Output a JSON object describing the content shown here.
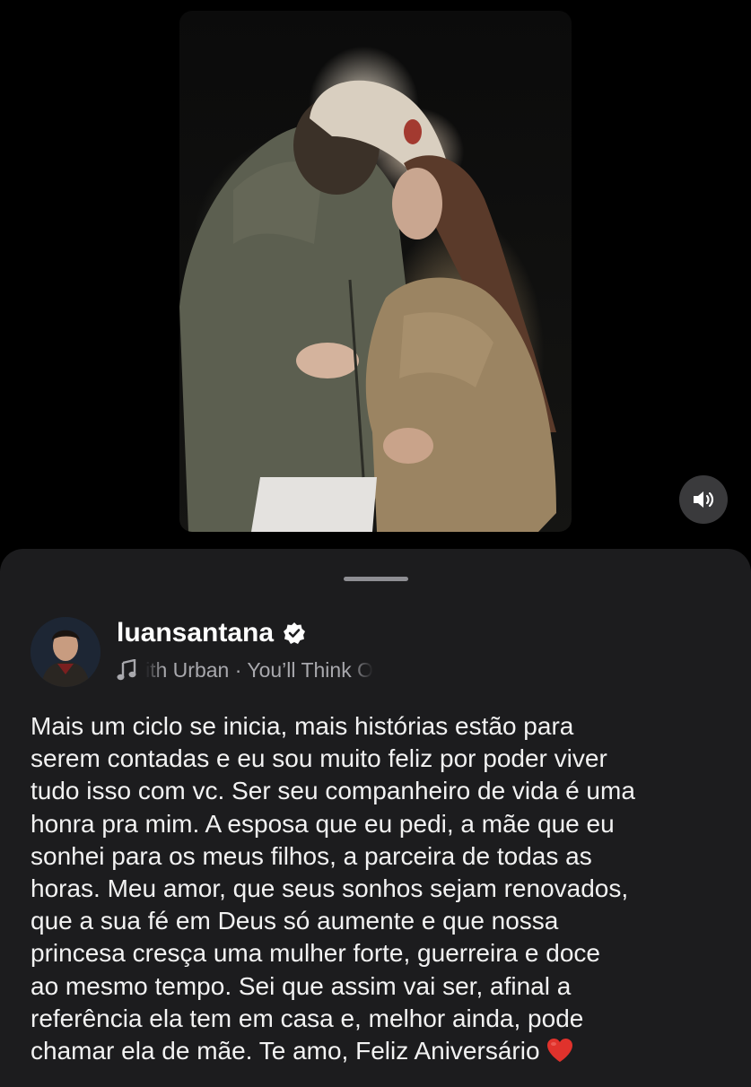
{
  "post": {
    "media": {
      "type": "video",
      "description_icon": "sound-on-icon"
    },
    "sound_button": {
      "icon": "speaker-icon"
    }
  },
  "sheet": {
    "author": {
      "username": "luansantana",
      "verified": true
    },
    "music": {
      "icon": "music-note-icon",
      "track": "ith Urban · You’ll Think O"
    },
    "caption_lines": [
      "Mais um ciclo se inicia, mais histórias estão para",
      "serem contadas e eu sou muito feliz por poder viver",
      "tudo isso com vc. Ser seu companheiro de vida é uma",
      "honra pra mim. A esposa que eu pedi, a mãe que eu",
      "sonhei para os meus filhos, a parceira de todas as",
      "horas. Meu amor, que seus sonhos sejam renovados,",
      "que a sua fé em Deus só aumente e que nossa",
      "princesa cresça uma mulher forte, guerreira e doce",
      "ao mesmo tempo. Sei que assim vai ser, afinal a",
      "referência ela tem em casa e, melhor ainda, pode",
      "chamar ela de mãe. Te amo, Feliz Aniversário"
    ],
    "caption_emoji": "red-heart-icon"
  },
  "colors": {
    "background": "#000000",
    "sheet": "#1c1c1e",
    "text": "#f2f2f2",
    "muted": "#a8a8ad",
    "heart": "#e0322c"
  }
}
